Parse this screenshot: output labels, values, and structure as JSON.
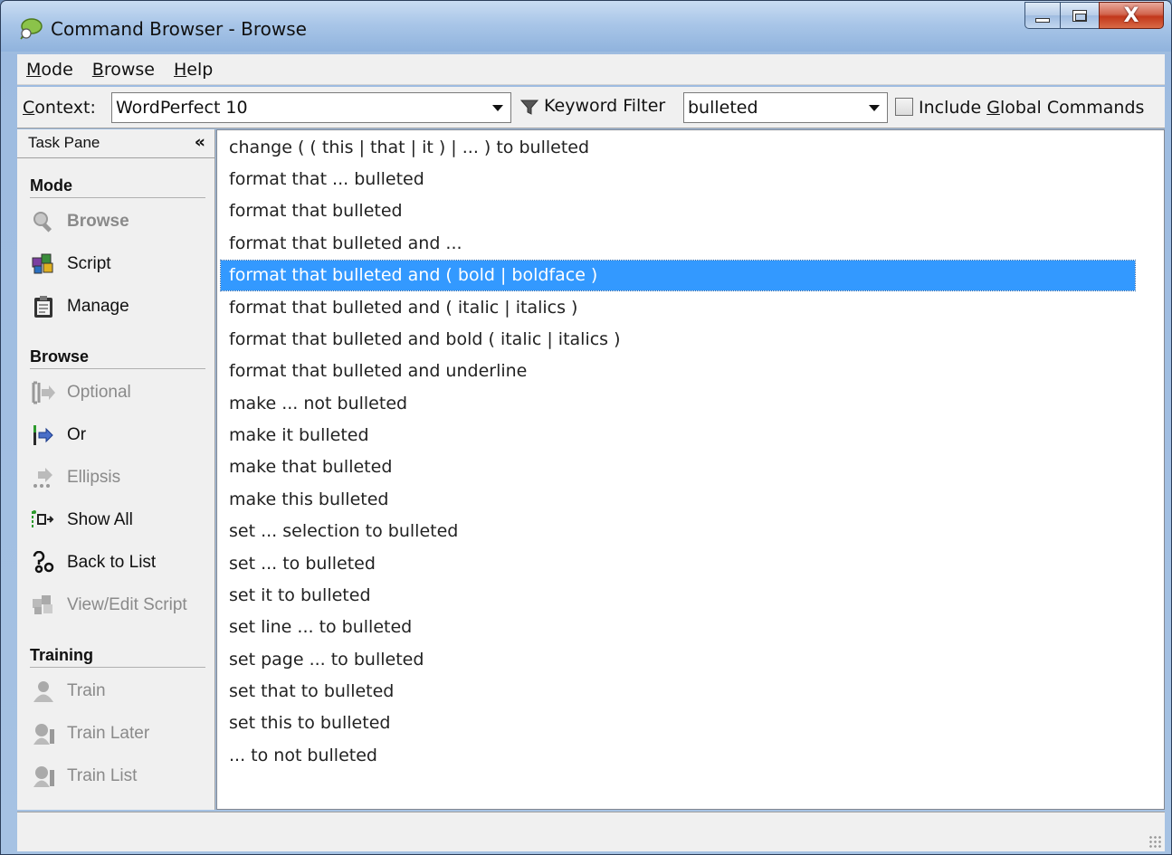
{
  "window": {
    "title": "Command Browser - Browse"
  },
  "menu": [
    {
      "label_u": "M",
      "label_rest": "ode"
    },
    {
      "label_u": "B",
      "label_rest": "rowse"
    },
    {
      "label_u": "H",
      "label_rest": "elp"
    }
  ],
  "toolbar": {
    "context_label_u": "C",
    "context_label_rest": "ontext:",
    "context_value": "WordPerfect 10",
    "keyword_filter_label": "Keyword Filter",
    "keyword_value": "bulleted",
    "global_label_before": "Include ",
    "global_label_u": "G",
    "global_label_after": "lobal Commands",
    "global_checked": false
  },
  "task_pane": {
    "title": "Task Pane",
    "collapse_glyph": "«",
    "sections": {
      "mode": "Mode",
      "browse": "Browse",
      "training": "Training"
    },
    "mode_items": [
      "Browse",
      "Script",
      "Manage"
    ],
    "browse_items": [
      "Optional",
      "Or",
      "Ellipsis",
      "Show All",
      "Back to List",
      "View/Edit Script"
    ],
    "training_items": [
      "Train",
      "Train Later",
      "Train List"
    ]
  },
  "commands": [
    "change ( ( this | that | it ) | ... ) to bulleted",
    "format that ... bulleted",
    "format that bulleted",
    "format that bulleted and ...",
    "format that bulleted and ( bold | boldface )",
    "format that bulleted and ( italic | italics )",
    "format that bulleted and bold ( italic | italics )",
    "format that bulleted and underline",
    "make ... not bulleted",
    "make it bulleted",
    "make that bulleted",
    "make this bulleted",
    "set ... selection to bulleted",
    "set ... to bulleted",
    "set it to bulleted",
    "set line ... to bulleted",
    "set page ... to bulleted",
    "set that to bulleted",
    "set this to bulleted",
    "... to not bulleted"
  ],
  "selected_command": "format that bulleted and ( bold | boldface )",
  "colors": {
    "selection": "#3399ff",
    "disabled_text": "#8a8a8a"
  }
}
